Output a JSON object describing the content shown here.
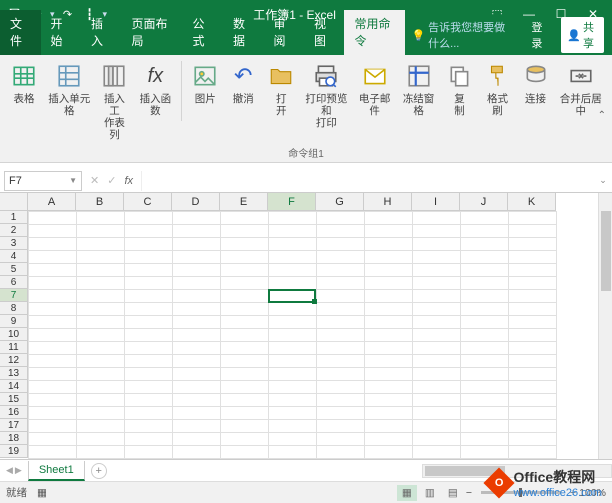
{
  "window": {
    "title": "工作簿1 - Excel"
  },
  "menubar": {
    "file": "文件",
    "items": [
      "开始",
      "插入",
      "页面布局",
      "公式",
      "数据",
      "审阅",
      "视图",
      "常用命令"
    ],
    "active_index": 7,
    "tell_me": "告诉我您想要做什么...",
    "login": "登录",
    "share": "共享"
  },
  "ribbon": {
    "buttons": [
      {
        "label": "表格"
      },
      {
        "label": "插入单元格"
      },
      {
        "label": "插入工\n作表列"
      },
      {
        "label": "插入函数"
      },
      {
        "label": "图片"
      },
      {
        "label": "撤消"
      },
      {
        "label": "打\n开"
      },
      {
        "label": "打印预览和\n打印"
      },
      {
        "label": "电子邮件"
      },
      {
        "label": "冻结窗格"
      },
      {
        "label": "复\n制"
      },
      {
        "label": "格式刷"
      },
      {
        "label": "连接"
      },
      {
        "label": "合并后居中"
      }
    ],
    "group_label": "命令组1"
  },
  "formula_bar": {
    "name_box": "F7",
    "formula": ""
  },
  "grid": {
    "columns": [
      "A",
      "B",
      "C",
      "D",
      "E",
      "F",
      "G",
      "H",
      "I",
      "J",
      "K"
    ],
    "rows": [
      "1",
      "2",
      "3",
      "4",
      "5",
      "6",
      "7",
      "8",
      "9",
      "10",
      "11",
      "12",
      "13",
      "14",
      "15",
      "16",
      "17",
      "18",
      "19"
    ],
    "selected_col_index": 5,
    "selected_row_index": 6
  },
  "sheet_tabs": {
    "active": "Sheet1"
  },
  "statusbar": {
    "ready": "就绪",
    "zoom": "100%"
  },
  "watermark": {
    "title1": "Office",
    "title2": "教程网",
    "url": "www.office26.com"
  }
}
